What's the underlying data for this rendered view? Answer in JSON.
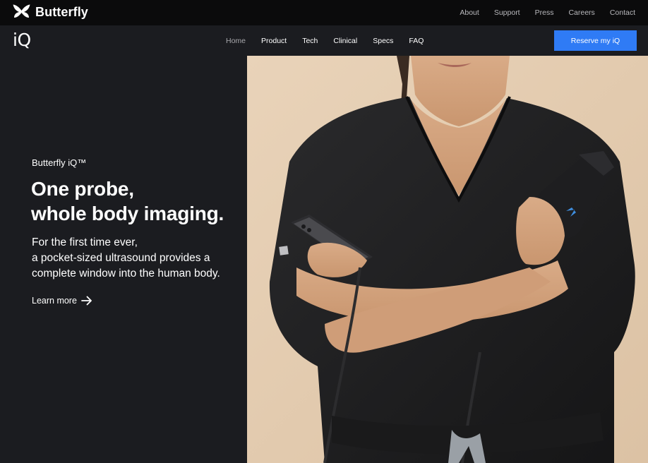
{
  "brand": {
    "name": "Butterfly",
    "logo_icon": "butterfly-logo-icon"
  },
  "utility_nav": [
    {
      "label": "About"
    },
    {
      "label": "Support"
    },
    {
      "label": "Press"
    },
    {
      "label": "Careers"
    },
    {
      "label": "Contact"
    }
  ],
  "product_bar": {
    "product_logo": "iQ",
    "nav": [
      {
        "label": "Home",
        "active": true
      },
      {
        "label": "Product",
        "active": false
      },
      {
        "label": "Tech",
        "active": false
      },
      {
        "label": "Clinical",
        "active": false
      },
      {
        "label": "Specs",
        "active": false
      },
      {
        "label": "FAQ",
        "active": false
      }
    ],
    "cta_label": "Reserve my iQ"
  },
  "hero": {
    "eyebrow": "Butterfly iQ™",
    "headline_lines": [
      "One probe,",
      "whole body imaging."
    ],
    "subcopy_lines": [
      "For the first time ever,",
      "a pocket-sized ultrasound provides a",
      "complete window into the human body."
    ],
    "learn_more_label": "Learn more",
    "learn_more_icon": "arrow-right-icon",
    "image_subject": "clinician-holding-phone-and-probe"
  },
  "colors": {
    "top_bar": "#0b0b0c",
    "page_background": "#1b1c20",
    "accent": "#2f7bf5",
    "image_background": "#e6d0b6"
  }
}
